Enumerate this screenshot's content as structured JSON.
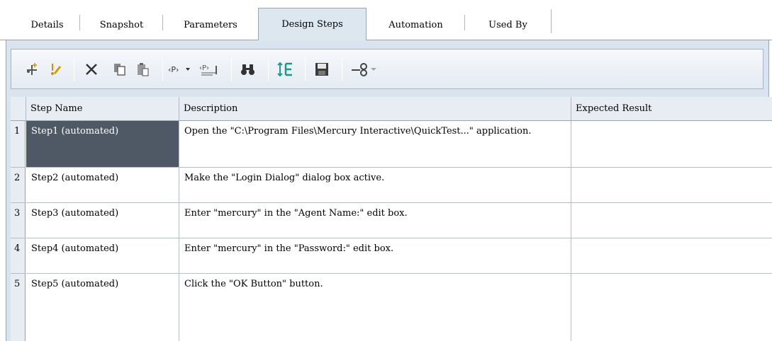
{
  "tabs": [
    {
      "label": "Details"
    },
    {
      "label": "Snapshot"
    },
    {
      "label": "Parameters"
    },
    {
      "label": "Design Steps"
    },
    {
      "label": "Automation"
    },
    {
      "label": "Used By"
    }
  ],
  "active_tab": "Design Steps",
  "toolbar": {
    "buttons": [
      "new-step-icon",
      "edit-step-icon",
      "delete-icon",
      "copy-icon",
      "paste-icon",
      "insert-parameter-icon",
      "parameter-dropdown-icon",
      "find-parameter-icon",
      "find-icon",
      "renumber-steps-icon",
      "save-icon",
      "link-icon",
      "link-dropdown-icon"
    ]
  },
  "grid": {
    "columns": [
      "Step Name",
      "Description",
      "Expected Result"
    ],
    "rows": [
      {
        "num": "1",
        "step": "Step1 (automated)",
        "desc": "Open the  \"C:\\Program Files\\Mercury Interactive\\QuickTest...\" application.",
        "expected": ""
      },
      {
        "num": "2",
        "step": "Step2 (automated)",
        "desc": "Make the \"Login Dialog\" dialog box active.",
        "expected": ""
      },
      {
        "num": "3",
        "step": "Step3 (automated)",
        "desc": "Enter \"mercury\" in the \"Agent Name:\" edit box.",
        "expected": ""
      },
      {
        "num": "4",
        "step": "Step4 (automated)",
        "desc": "Enter \"mercury\" in the \"Password:\" edit box.",
        "expected": ""
      },
      {
        "num": "5",
        "step": "Step5 (automated)",
        "desc": "Click the \"OK Button\" button.",
        "expected": ""
      }
    ]
  },
  "colors": {
    "selected_cell": "#4f5966",
    "panel": "#d9e4ef",
    "header": "#e8edf4"
  }
}
